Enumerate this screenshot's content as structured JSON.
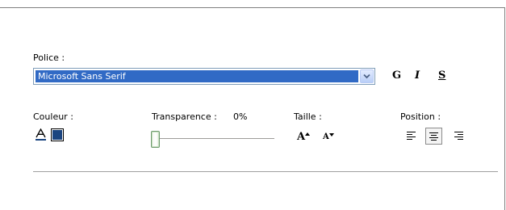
{
  "font": {
    "label": "Police :",
    "selected": "Microsoft Sans Serif"
  },
  "style_buttons": {
    "bold": "G",
    "italic": "I",
    "underline": "S"
  },
  "color": {
    "label": "Couleur :",
    "swatch": "#1b4580",
    "text_icon_letter": "A"
  },
  "transparency": {
    "label": "Transparence :",
    "value_text": "0%",
    "value": 0
  },
  "size": {
    "label": "Taille :",
    "increase": "A",
    "decrease": "A"
  },
  "position": {
    "label": "Position :",
    "options": [
      "left",
      "center",
      "right"
    ],
    "selected": "center"
  },
  "icons": {
    "dropdown": "chevron-down-icon",
    "text_color": "text-color-icon",
    "align_left": "align-left-icon",
    "align_center": "align-center-icon",
    "align_right": "align-right-icon"
  }
}
